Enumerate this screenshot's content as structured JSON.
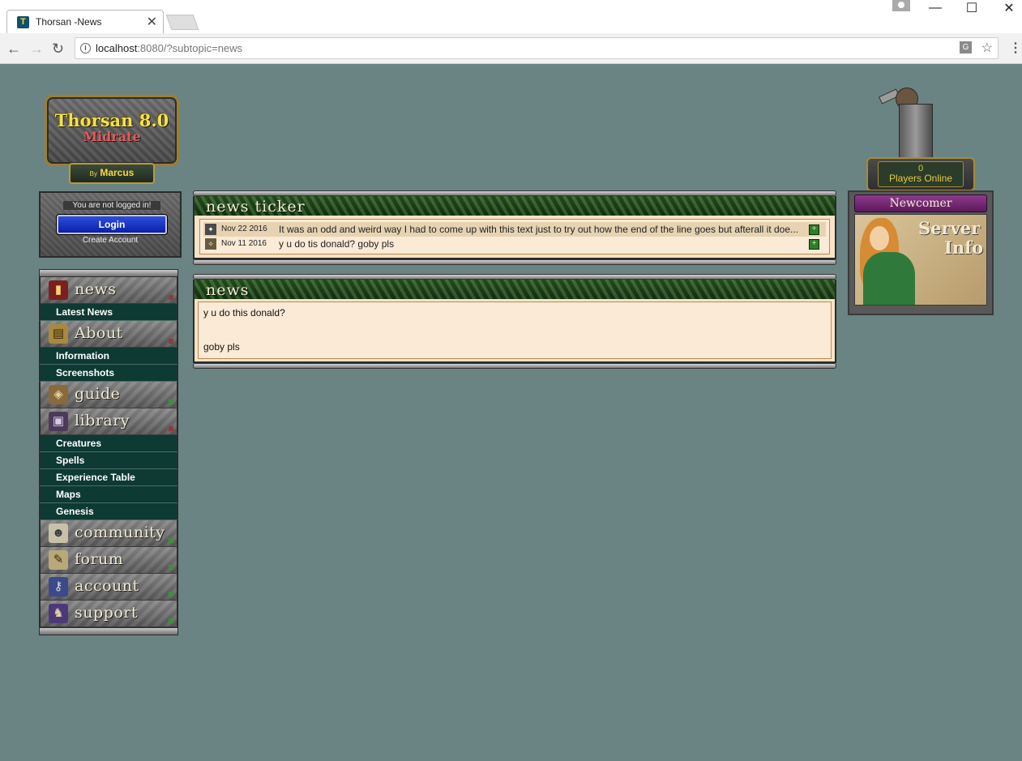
{
  "browser": {
    "tab_title": "Thorsan -News",
    "tab_favicon": "T",
    "url_host": "localhost",
    "url_rest": ":8080/?subtopic=news",
    "close_glyph": "✕",
    "minimize_glyph": "—",
    "maximize_glyph": "☐",
    "window_close_glyph": "✕",
    "back_glyph": "←",
    "forward_glyph": "→",
    "reload_glyph": "↻",
    "star_glyph": "☆",
    "menu_glyph": "⋮",
    "info_glyph": "i",
    "translate_glyph": "G"
  },
  "logo": {
    "title": "Thorsan 8.0",
    "subtitle": "Midrate",
    "by": "By",
    "author": "Marcus"
  },
  "login": {
    "status": "You are not logged in!",
    "button": "Login",
    "create": "Create Account"
  },
  "menu": {
    "news": "news",
    "latest_news": "Latest News",
    "about": "About",
    "information": "Information",
    "screenshots": "Screenshots",
    "guide": "guide",
    "library": "library",
    "creatures": "Creatures",
    "spells": "Spells",
    "experience_table": "Experience Table",
    "maps": "Maps",
    "genesis": "Genesis",
    "community": "community",
    "forum": "forum",
    "account": "account",
    "support": "support"
  },
  "ticker": {
    "title": "news ticker",
    "items": [
      {
        "date": "Nov 22 2016",
        "text": "It was an odd and weird way I had to come up with this text just to try out how the end of the line goes but afterall it doe..."
      },
      {
        "date": "Nov 11 2016",
        "text": "y u do tis donald? goby pls"
      }
    ],
    "toggle_glyph": "+"
  },
  "news": {
    "title": "news",
    "line1": "y u do this donald?",
    "line2": "goby pls"
  },
  "right": {
    "players_count": "0",
    "players_label": "Players Online",
    "newcomer": "Newcomer",
    "server": "Server",
    "info": "Info"
  },
  "colors": {
    "background": "#6a8483",
    "menu_sub_bg": "#0d3a33",
    "login_button": "#1a35c8",
    "panel_bg": "#f7e3c5",
    "header_green": "#234a1f"
  }
}
